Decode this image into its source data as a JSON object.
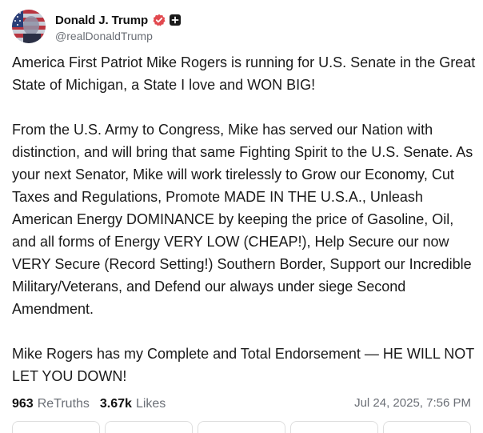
{
  "author": {
    "display_name": "Donald J. Trump",
    "handle": "@realDonaldTrump",
    "avatar": "avatar-photo",
    "verified_icon": "verified-badge-icon",
    "verified_color": "#e2494f",
    "extra_icon": "plus-icon"
  },
  "post": {
    "paragraphs": [
      "America First Patriot Mike Rogers is running for U.S. Senate in the Great State of Michigan, a State I love and WON BIG!",
      "From the U.S. Army to Congress, Mike has served our Nation with distinction, and will bring that same Fighting Spirit to the U.S. Senate. As your next Senator, Mike will work tirelessly to Grow our Economy, Cut Taxes and Regulations, Promote MADE IN THE U.S.A., Unleash American Energy DOMINANCE by keeping the price of Gasoline, Oil, and all forms of Energy VERY LOW (CHEAP!), Help Secure our now VERY Secure (Record Setting!) Southern Border, Support our Incredible Military/Veterans, and Defend our always under siege Second Amendment.",
      "Mike Rogers has my Complete and Total Endorsement — HE WILL NOT LET YOU DOWN!"
    ]
  },
  "stats": {
    "retruths_count": "963",
    "retruths_label": "ReTruths",
    "likes_count": "3.67k",
    "likes_label": "Likes",
    "timestamp": "Jul 24, 2025, 7:56 PM"
  }
}
